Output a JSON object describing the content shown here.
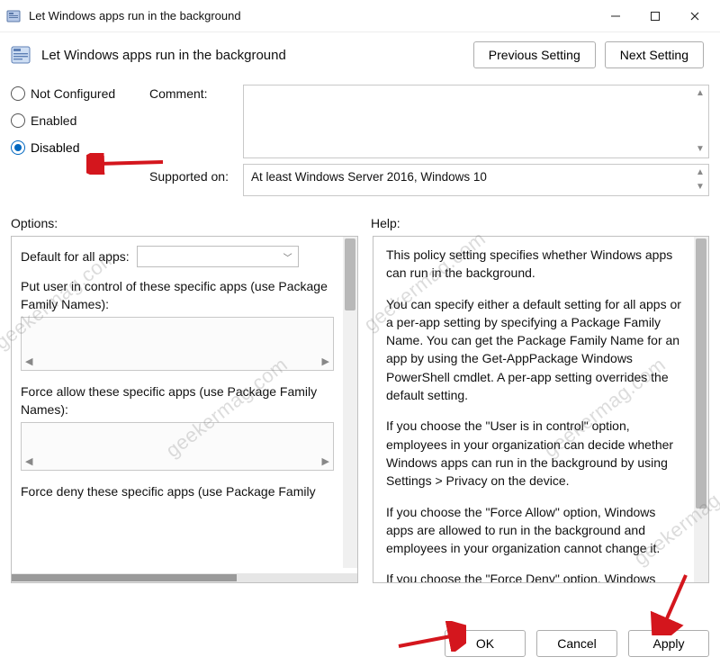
{
  "window": {
    "title": "Let Windows apps run in the background"
  },
  "header": {
    "policy_title": "Let Windows apps run in the background",
    "prev_button": "Previous Setting",
    "next_button": "Next Setting"
  },
  "radios": {
    "not_configured": "Not Configured",
    "enabled": "Enabled",
    "disabled": "Disabled",
    "selected": "disabled"
  },
  "labels": {
    "comment": "Comment:",
    "supported_on": "Supported on:",
    "options": "Options:",
    "help": "Help:"
  },
  "comment_value": "",
  "supported_on_value": "At least Windows Server 2016, Windows 10",
  "options_pane": {
    "default_for_all_apps_label": "Default for all apps:",
    "default_for_all_apps_value": "",
    "put_user_in_control_label": "Put user in control of these specific apps (use Package Family Names):",
    "force_allow_label": "Force allow these specific apps (use Package Family Names):",
    "force_deny_label": "Force deny these specific apps (use Package Family"
  },
  "help_text": {
    "p1": "This policy setting specifies whether Windows apps can run in the background.",
    "p2": "You can specify either a default setting for all apps or a per-app setting by specifying a Package Family Name. You can get the Package Family Name for an app by using the Get-AppPackage Windows PowerShell cmdlet. A per-app setting overrides the default setting.",
    "p3": "If you choose the \"User is in control\" option, employees in your organization can decide whether Windows apps can run in the background by using Settings > Privacy on the device.",
    "p4": "If you choose the \"Force Allow\" option, Windows apps are allowed to run in the background and employees in your organization cannot change it.",
    "p5": "If you choose the \"Force Deny\" option, Windows apps are not allowed to run in the background and employees in your organization cannot change it."
  },
  "buttons": {
    "ok": "OK",
    "cancel": "Cancel",
    "apply": "Apply"
  },
  "watermark_text": "geekermag.com",
  "annotation": {
    "arrow_color": "#d4161d"
  }
}
